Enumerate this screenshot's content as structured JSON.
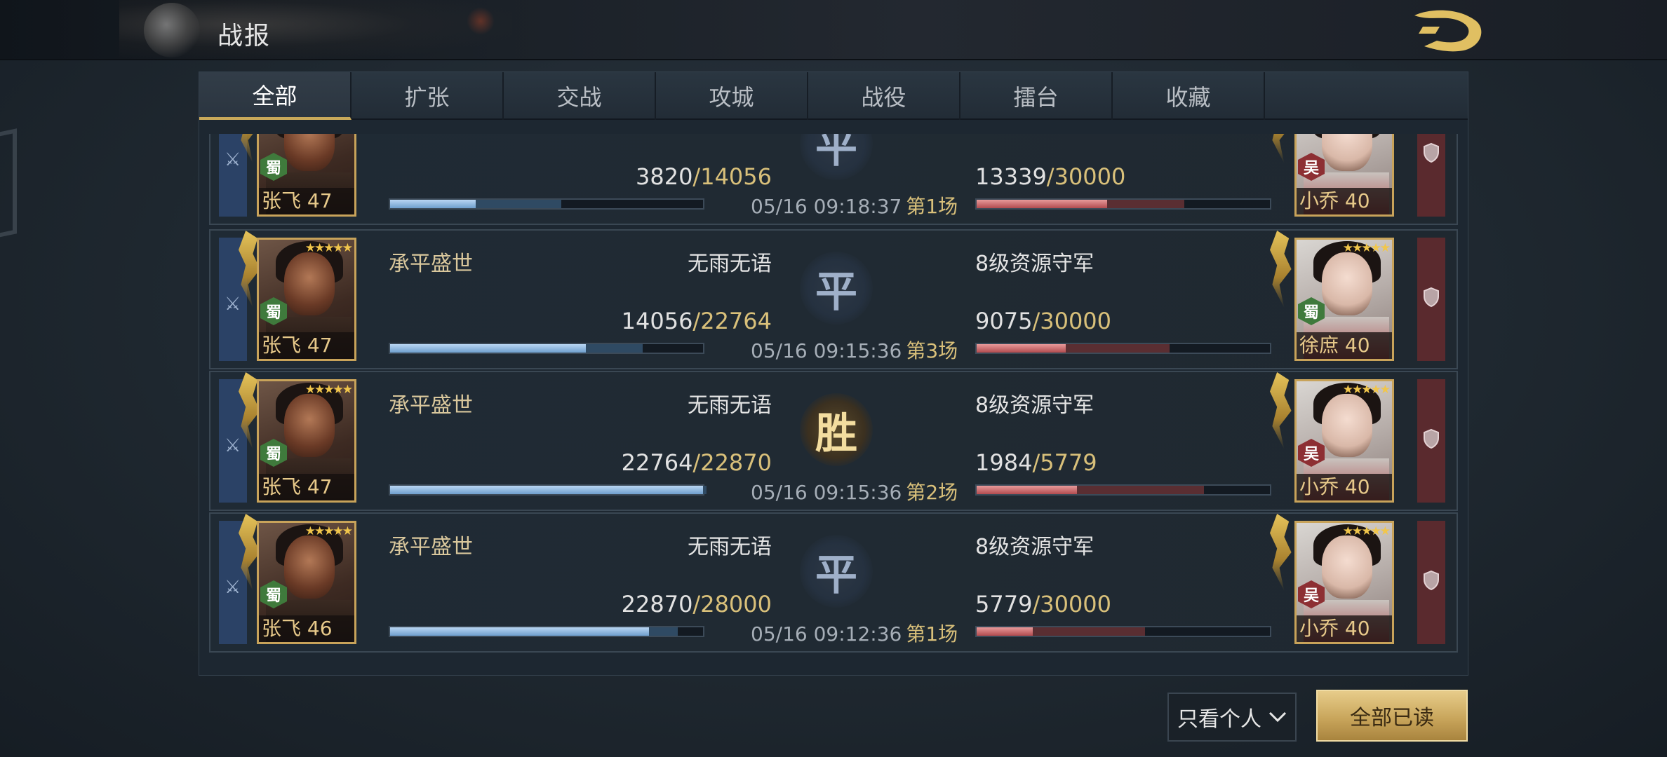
{
  "header": {
    "title": "战报"
  },
  "tabs": [
    "全部",
    "扩张",
    "交战",
    "攻城",
    "战役",
    "擂台",
    "收藏"
  ],
  "reports": [
    {
      "attacker_team": "",
      "defender_team": "",
      "defender_name_b": "",
      "left_hero": "张飞",
      "left_level": "47",
      "left_faction": "蜀",
      "left_stars": "",
      "left_hp": "3820",
      "left_hp_max": "14056",
      "left_hp_frac": 0.27,
      "left_start_frac": 0.54,
      "result": "平",
      "result_type": "draw",
      "time": "05/16 09:18:37",
      "round": "第1场",
      "right_hp": "13339",
      "right_hp_max": "30000",
      "right_hp_frac": 0.44,
      "right_start_frac": 0.7,
      "right_hero": "小乔",
      "right_level": "40",
      "right_faction": "吴",
      "right_stars": ""
    },
    {
      "attacker_team": "承平盛世",
      "defender_team": "无雨无语",
      "defender_name_b": "8级资源守军",
      "left_hero": "张飞",
      "left_level": "47",
      "left_faction": "蜀",
      "left_stars": "★★★★★",
      "left_hp": "14056",
      "left_hp_max": "22764",
      "left_hp_frac": 0.62,
      "left_start_frac": 0.8,
      "result": "平",
      "result_type": "draw",
      "time": "05/16 09:15:36",
      "round": "第3场",
      "right_hp": "9075",
      "right_hp_max": "30000",
      "right_hp_frac": 0.3,
      "right_start_frac": 0.65,
      "right_hero": "徐庶",
      "right_level": "40",
      "right_faction": "蜀",
      "right_stars": "★★★★★"
    },
    {
      "attacker_team": "承平盛世",
      "defender_team": "无雨无语",
      "defender_name_b": "8级资源守军",
      "left_hero": "张飞",
      "left_level": "47",
      "left_faction": "蜀",
      "left_stars": "★★★★★",
      "left_hp": "22764",
      "left_hp_max": "22870",
      "left_hp_frac": 0.99,
      "left_start_frac": 1.0,
      "result": "胜",
      "result_type": "win",
      "time": "05/16 09:15:36",
      "round": "第2场",
      "right_hp": "1984",
      "right_hp_max": "5779",
      "right_hp_frac": 0.34,
      "right_start_frac": 0.77,
      "right_hero": "小乔",
      "right_level": "40",
      "right_faction": "吴",
      "right_stars": "★★★★★"
    },
    {
      "attacker_team": "承平盛世",
      "defender_team": "无雨无语",
      "defender_name_b": "8级资源守军",
      "left_hero": "张飞",
      "left_level": "46",
      "left_faction": "蜀",
      "left_stars": "★★★★★",
      "left_hp": "22870",
      "left_hp_max": "28000",
      "left_hp_frac": 0.82,
      "left_start_frac": 0.91,
      "result": "平",
      "result_type": "draw",
      "time": "05/16 09:12:36",
      "round": "第1场",
      "right_hp": "5779",
      "right_hp_max": "30000",
      "right_hp_frac": 0.19,
      "right_start_frac": 0.57,
      "right_hero": "小乔",
      "right_level": "40",
      "right_faction": "吴",
      "right_stars": "★★★★★"
    }
  ],
  "footer": {
    "filter_label": "只看个人",
    "read_all_label": "全部已读"
  }
}
